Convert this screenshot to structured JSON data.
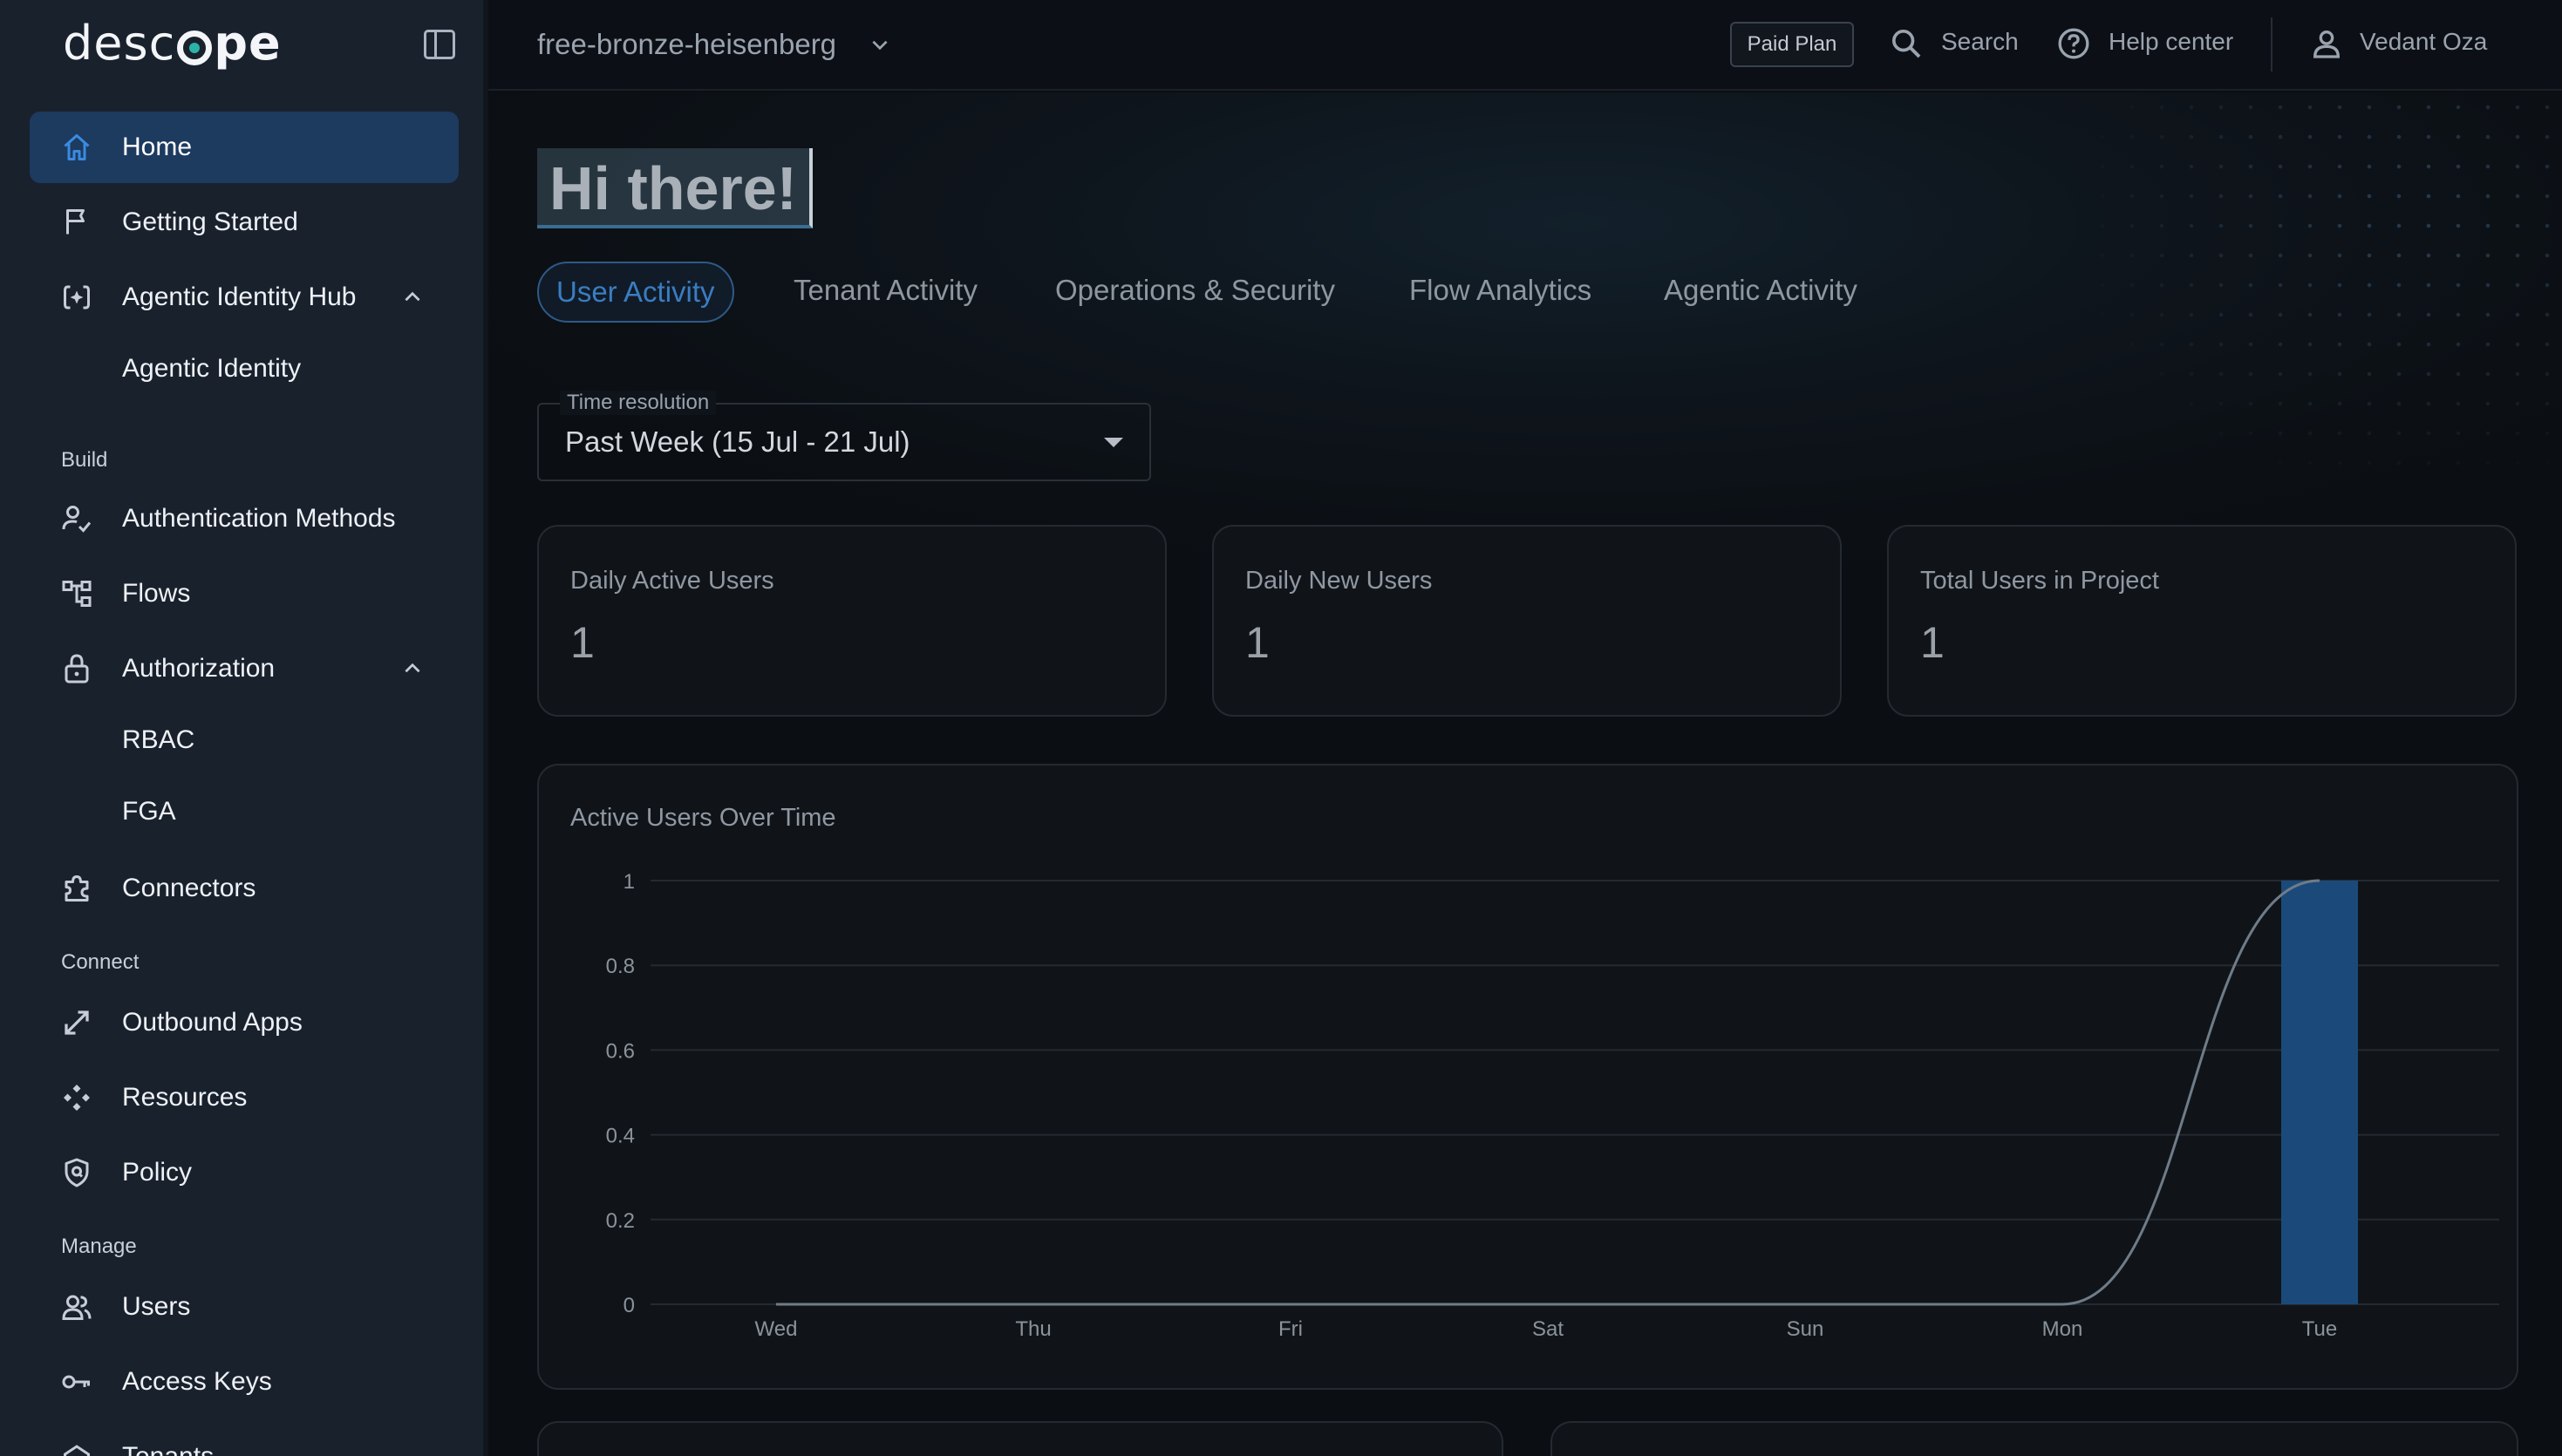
{
  "sidebar": {
    "logo": {
      "part1": "desc",
      "part2": "pe"
    },
    "items": [
      {
        "label": "Home"
      },
      {
        "label": "Getting Started"
      },
      {
        "label": "Agentic Identity Hub"
      },
      {
        "label": "Agentic Identity"
      },
      {
        "label": "Authentication Methods"
      },
      {
        "label": "Flows"
      },
      {
        "label": "Authorization"
      },
      {
        "label": "RBAC"
      },
      {
        "label": "FGA"
      },
      {
        "label": "Connectors"
      },
      {
        "label": "Outbound Apps"
      },
      {
        "label": "Resources"
      },
      {
        "label": "Policy"
      },
      {
        "label": "Users"
      },
      {
        "label": "Access Keys"
      },
      {
        "label": "Tenants"
      }
    ],
    "sections": {
      "build": "Build",
      "connect": "Connect",
      "manage": "Manage"
    }
  },
  "topbar": {
    "project": "free-bronze-heisenberg",
    "plan_badge": "Paid Plan",
    "search": "Search",
    "help": "Help center",
    "user": "Vedant Oza"
  },
  "main": {
    "greeting": "Hi there!",
    "tabs": [
      {
        "label": "User Activity"
      },
      {
        "label": "Tenant Activity"
      },
      {
        "label": "Operations & Security"
      },
      {
        "label": "Flow Analytics"
      },
      {
        "label": "Agentic Activity"
      }
    ],
    "time_resolution": {
      "label": "Time resolution",
      "value": "Past Week (15 Jul - 21 Jul)"
    },
    "stats": [
      {
        "title": "Daily Active Users",
        "value": "1"
      },
      {
        "title": "Daily New Users",
        "value": "1"
      },
      {
        "title": "Total Users in Project",
        "value": "1"
      }
    ]
  },
  "colors": {
    "accent": "#3a7dc1",
    "bar": "#1b4a7a",
    "line": "#6f7c88",
    "grid": "#242a31"
  },
  "chart_data": {
    "type": "bar",
    "title": "Active Users Over Time",
    "categories": [
      "Wed",
      "Thu",
      "Fri",
      "Sat",
      "Sun",
      "Mon",
      "Tue"
    ],
    "series": [
      {
        "type": "bar",
        "values": [
          0,
          0,
          0,
          0,
          0,
          0,
          1
        ]
      },
      {
        "type": "line",
        "values": [
          0,
          0,
          0,
          0,
          0,
          0,
          1
        ]
      }
    ],
    "ylim": [
      0,
      1
    ],
    "yticks": [
      "0",
      "0.2",
      "0.4",
      "0.6",
      "0.8",
      "1"
    ],
    "grid": true
  }
}
